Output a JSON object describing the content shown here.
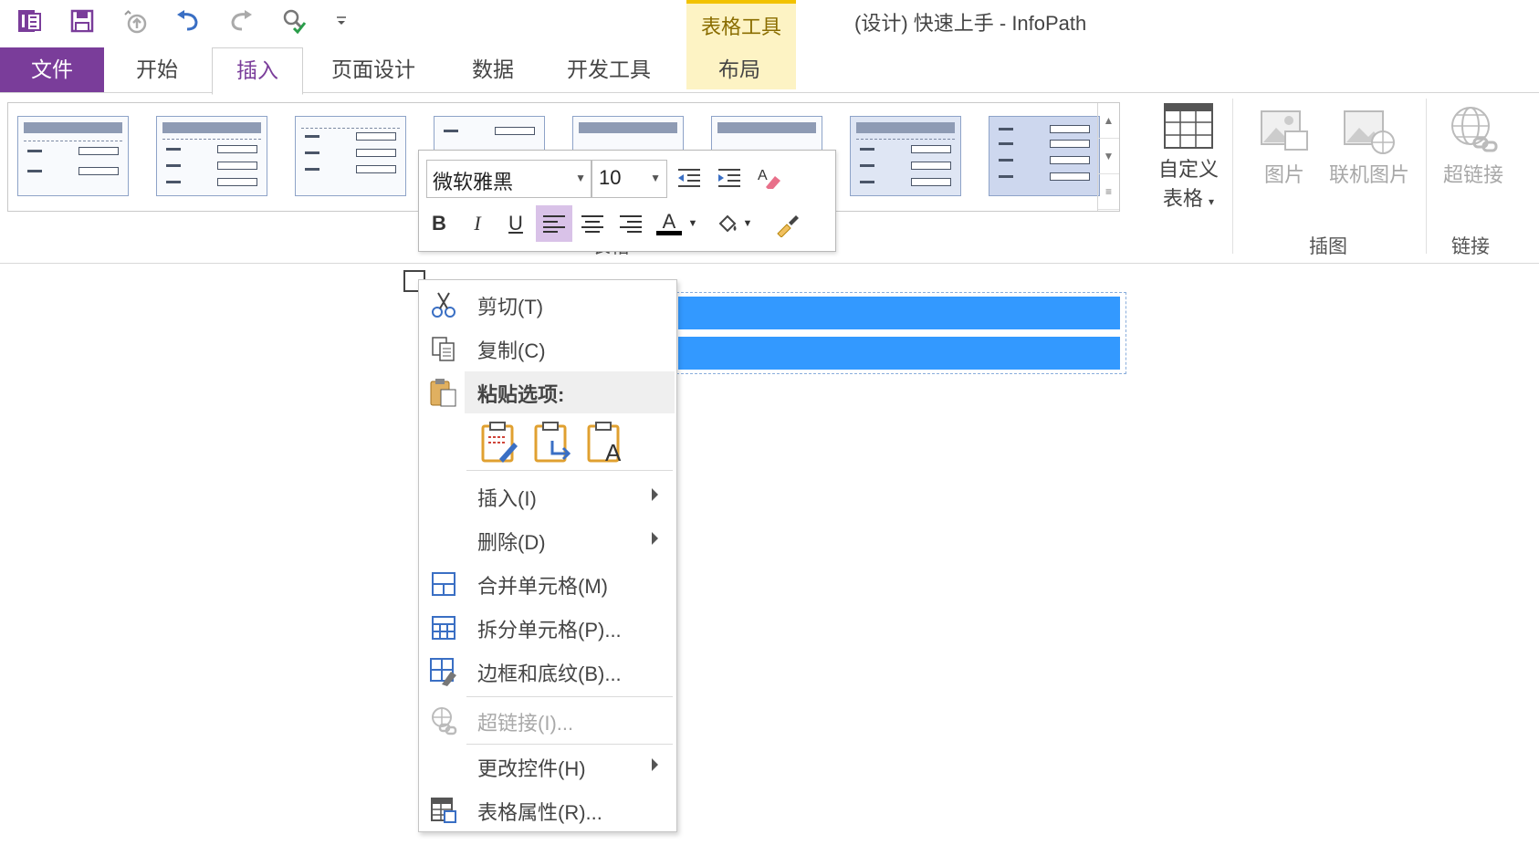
{
  "window": {
    "title": "(设计) 快速上手 - InfoPath",
    "context_group": "表格工具"
  },
  "tabs": [
    {
      "label": "文件"
    },
    {
      "label": "开始"
    },
    {
      "label": "插入"
    },
    {
      "label": "页面设计"
    },
    {
      "label": "数据"
    },
    {
      "label": "开发工具"
    },
    {
      "label": "布局"
    }
  ],
  "ribbon": {
    "custom_table": {
      "line1": "自定义",
      "line2": "表格"
    },
    "insert_group": {
      "picture": "图片",
      "online_picture": "联机图片",
      "label": "插图"
    },
    "link_group": {
      "hyperlink": "超链接",
      "label": "链接"
    },
    "tables_group_label_fragment": "表格"
  },
  "mini_toolbar": {
    "font": "微软雅黑",
    "size": "10",
    "bold": "B",
    "italic": "I",
    "underline": "U",
    "font_color_letter": "A"
  },
  "context_menu": {
    "cut": "剪切(T)",
    "copy": "复制(C)",
    "paste_options": "粘贴选项:",
    "insert": "插入(I)",
    "delete": "删除(D)",
    "merge": "合并单元格(M)",
    "split": "拆分单元格(P)...",
    "borders": "边框和底纹(B)...",
    "hyperlink": "超链接(I)...",
    "change_control": "更改控件(H)",
    "table_properties": "表格属性(R)..."
  },
  "colors": {
    "file_tab": "#7a3d9a",
    "selection": "#3399ff",
    "context_tab_bg": "#fdf3c4"
  }
}
